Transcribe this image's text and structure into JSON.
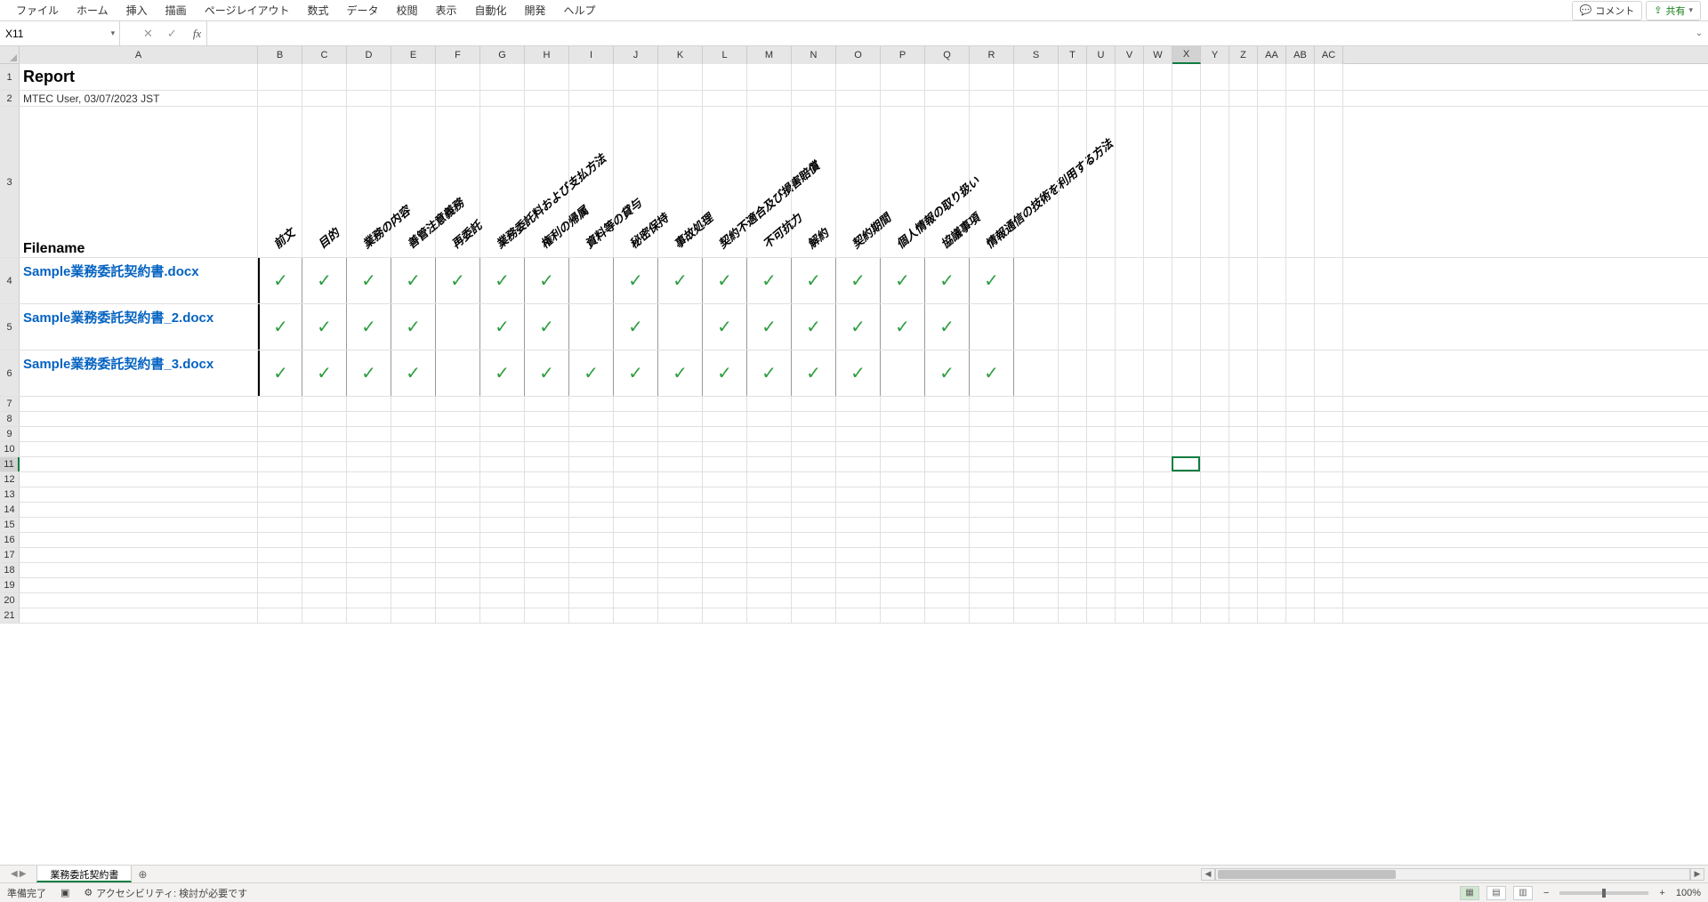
{
  "ribbon": {
    "items": [
      "ファイル",
      "ホーム",
      "挿入",
      "描画",
      "ページレイアウト",
      "数式",
      "データ",
      "校閲",
      "表示",
      "自動化",
      "開発",
      "ヘルプ"
    ],
    "comment_btn": "コメント",
    "share_btn": "共有"
  },
  "namebox": {
    "value": "X11"
  },
  "formula": {
    "value": ""
  },
  "columns": [
    "A",
    "B",
    "C",
    "D",
    "E",
    "F",
    "G",
    "H",
    "I",
    "J",
    "K",
    "L",
    "M",
    "N",
    "O",
    "P",
    "Q",
    "R",
    "S",
    "T",
    "U",
    "V",
    "W",
    "X",
    "Y",
    "Z",
    "AA",
    "AB",
    "AC"
  ],
  "selected_col": "X",
  "selected_row": 11,
  "report": {
    "title": "Report",
    "subtitle": "MTEC User, 03/07/2023 JST",
    "filename_header": "Filename"
  },
  "rot_headers": [
    "前文",
    "目的",
    "業務の内容",
    "善管注意義務",
    "再委託",
    "業務委託料および支払方法",
    "権利の帰属",
    "資料等の貸与",
    "秘密保持",
    "事故処理",
    "契約不適合及び損害賠償",
    "不可抗力",
    "解約",
    "契約期間",
    "個人情報の取り扱い",
    "協議事項",
    "情報通信の技術を利用する方法"
  ],
  "rows": [
    {
      "file": "Sample業務委託契約書.docx",
      "checks": [
        1,
        1,
        1,
        1,
        1,
        1,
        1,
        0,
        1,
        1,
        1,
        1,
        1,
        1,
        1,
        1,
        1
      ]
    },
    {
      "file": "Sample業務委託契約書_2.docx",
      "checks": [
        1,
        1,
        1,
        1,
        0,
        1,
        1,
        0,
        1,
        0,
        1,
        1,
        1,
        1,
        1,
        1,
        0
      ]
    },
    {
      "file": "Sample業務委託契約書_3.docx",
      "checks": [
        1,
        1,
        1,
        1,
        0,
        1,
        1,
        1,
        1,
        1,
        1,
        1,
        1,
        1,
        0,
        1,
        1
      ]
    }
  ],
  "extra_rows": [
    7,
    8,
    9,
    10,
    11,
    12,
    13,
    14,
    15,
    16,
    17,
    18,
    19,
    20,
    21
  ],
  "sheet_tab": "業務委託契約書",
  "status": {
    "ready": "準備完了",
    "accessibility": "アクセシビリティ: 検討が必要です",
    "zoom": "100%"
  }
}
